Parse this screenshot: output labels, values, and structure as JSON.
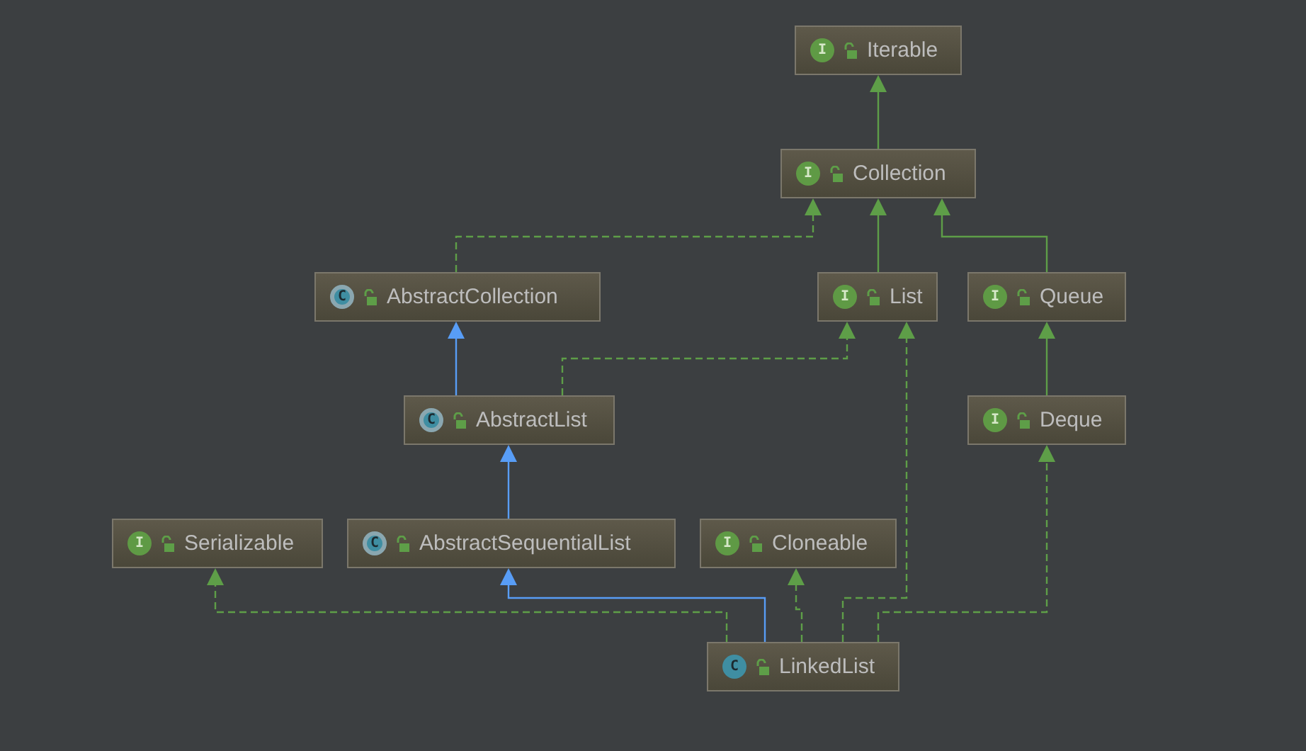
{
  "nodes": [
    {
      "name": "Iterable",
      "kind": "interface",
      "badge": "I"
    },
    {
      "name": "Collection",
      "kind": "interface",
      "badge": "I"
    },
    {
      "name": "AbstractCollection",
      "kind": "abstract",
      "badge": "C"
    },
    {
      "name": "List",
      "kind": "interface",
      "badge": "I"
    },
    {
      "name": "Queue",
      "kind": "interface",
      "badge": "I"
    },
    {
      "name": "AbstractList",
      "kind": "abstract",
      "badge": "C"
    },
    {
      "name": "Deque",
      "kind": "interface",
      "badge": "I"
    },
    {
      "name": "Serializable",
      "kind": "interface",
      "badge": "I"
    },
    {
      "name": "AbstractSequentialList",
      "kind": "abstract",
      "badge": "C"
    },
    {
      "name": "Cloneable",
      "kind": "interface",
      "badge": "I"
    },
    {
      "name": "LinkedList",
      "kind": "class",
      "badge": "C"
    }
  ],
  "edges": [
    {
      "kind": "interface_extends"
    },
    {
      "kind": "implements"
    },
    {
      "kind": "interface_extends"
    },
    {
      "kind": "interface_extends"
    },
    {
      "kind": "extends"
    },
    {
      "kind": "implements"
    },
    {
      "kind": "interface_extends"
    },
    {
      "kind": "extends"
    },
    {
      "kind": "extends"
    },
    {
      "kind": "implements"
    },
    {
      "kind": "implements"
    },
    {
      "kind": "implements"
    },
    {
      "kind": "implements"
    }
  ]
}
